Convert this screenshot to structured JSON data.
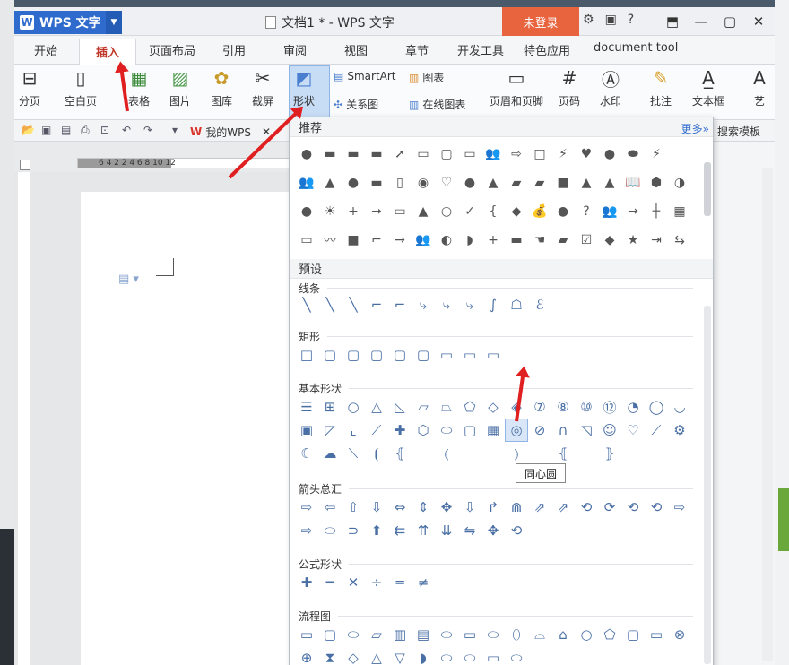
{
  "app": {
    "badge": "WPS 文字",
    "doc_title": "文档1 * - WPS 文字",
    "login": "未登录"
  },
  "tabs": [
    "开始",
    "插入",
    "页面布局",
    "引用",
    "审阅",
    "视图",
    "章节",
    "开发工具",
    "特色应用",
    "document tool"
  ],
  "ribbon": {
    "big": [
      "分页",
      "空白页",
      "表格",
      "图片",
      "图库",
      "截屏",
      "形状"
    ],
    "smartart": "SmartArt",
    "chart": "图表",
    "relation": "关系图",
    "online_chart": "在线图表",
    "header_footer": "页眉和页脚",
    "page_num": "页码",
    "watermark": "水印",
    "comment": "批注",
    "textbox": "文本框",
    "art": "艺"
  },
  "qbar": {
    "doc_tab": "我的WPS",
    "search_tpl": "搜索模板"
  },
  "ruler": {
    "numbers": "6  4  2     2  4  6  8  10  12"
  },
  "panel": {
    "recommend": "推荐",
    "more": "更多»",
    "preset": "预设",
    "line_cut": "线条",
    "rect": "矩形",
    "basic": "基本形状",
    "arrows": "箭头总汇",
    "formula": "公式形状",
    "flow": "流程图",
    "tooltip": "同心圆",
    "rec_rows": [
      "●▬▬▬➚▭▢▭👥⇨□⚡♥●⬬⚡",
      "👥▲●▬▯◉♡●▲▰▰■▲▲📖⬢◑",
      "●☀+➞▭▲○✓{◆💰●?👥→┼▦",
      "▭〰■⌐→👥◐◗+▬☚▰☑◆★⇥⇆"
    ],
    "line_row": "╲╲╲⌐⌐⤷⤷⤷∫☖ℰ",
    "rect_row": "□▢▢▢▢▢▭▭▭",
    "basic_rows": [
      "☰⊞○△◺▱⏢⬠◇◈⑦⑧⑩⑫◔◯◡",
      "▣◸⌞⟋✚⬡⬭▢▦◎⊘∩◹☺♡⟋⚙",
      "☾☁⟍⦗⦃ ⦅  ⦆ ⦃ ⦄"
    ],
    "arrow_rows": [
      "⇨⇦⇧⇩⇔⇕✥⇩↱⋒⇗⇗⟲⟳⟲⟲⇨",
      "⇨⬭⊃⬆⇇⇈⇊⇋✥⟲"
    ],
    "formula_row": "✚━✕÷═≠",
    "flow_rows": [
      "▭▢⬭▱▥▤⬭▭⬭⬯⌓⌂○⬠▢▭⊗",
      "⊕⧗◇△▽◗⬭⬭▭⬭"
    ]
  },
  "colors": {
    "accent": "#2f6bcd",
    "login": "#e8643f",
    "arrow": "#e02020"
  }
}
